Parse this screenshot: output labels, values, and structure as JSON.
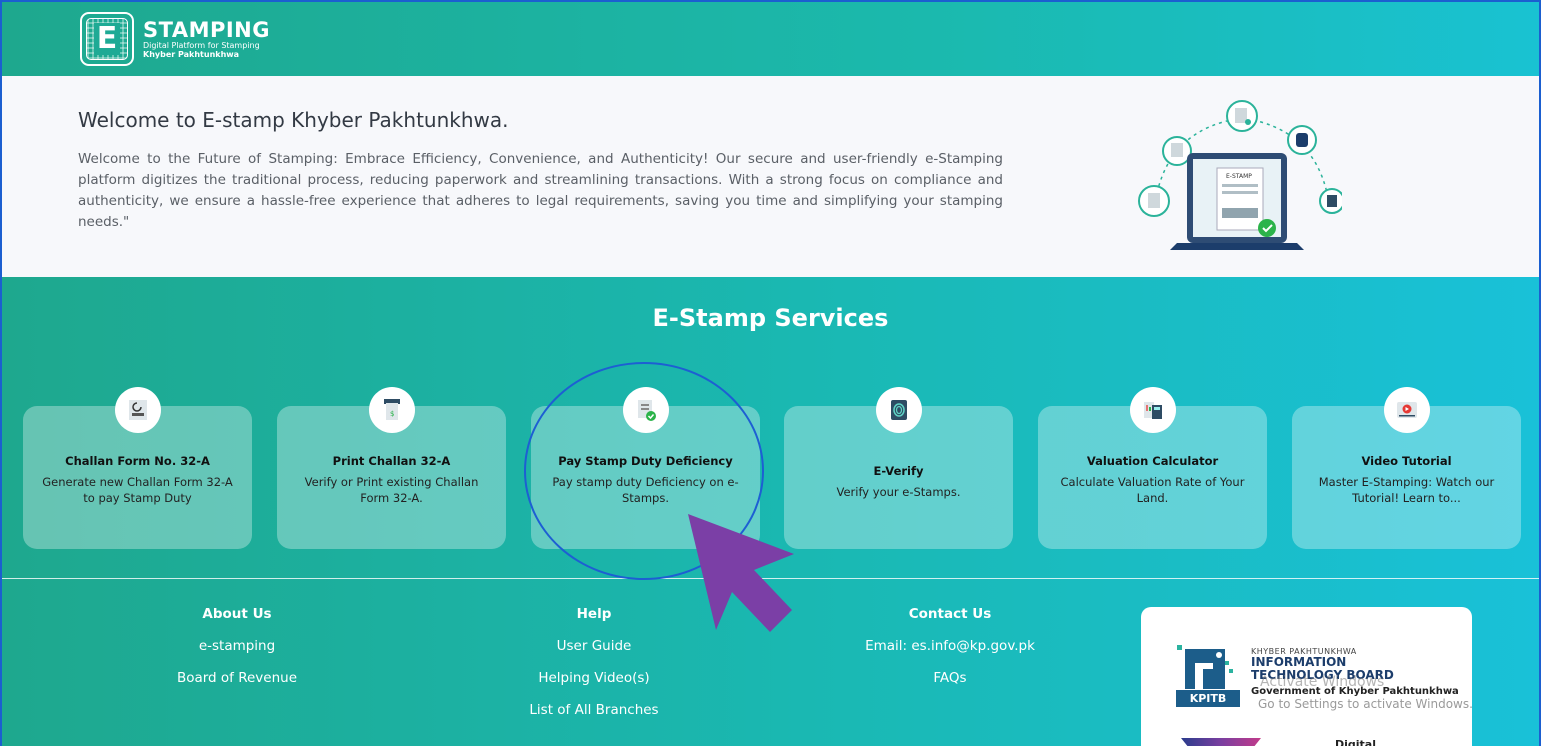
{
  "header": {
    "logo_letter": "E",
    "logo_title": "STAMPING",
    "logo_subtitle_line1": "Digital Platform for Stamping",
    "logo_subtitle_line2": "Khyber Pakhtunkhwa"
  },
  "welcome": {
    "title": "Welcome to E-stamp Khyber Pakhtunkhwa.",
    "body": "Welcome to the Future of Stamping: Embrace Efficiency, Convenience, and Authenticity! Our secure and user-friendly e-Stamping platform digitizes the traditional process, reducing paperwork and streamlining transactions. With a strong focus on compliance and authenticity, we ensure a hassle-free experience that adheres to legal requirements, saving you time and simplifying your stamping needs.\"",
    "illustration_label": "E-STAMP"
  },
  "services": {
    "title": "E-Stamp Services",
    "cards": [
      {
        "title": "Challan Form No. 32-A",
        "desc": "Generate new Challan Form 32-A to pay Stamp Duty",
        "icon": "receipt-icon"
      },
      {
        "title": "Print Challan 32-A",
        "desc": "Verify or Print existing Challan Form 32-A.",
        "icon": "printer-icon"
      },
      {
        "title": "Pay Stamp Duty Deficiency",
        "desc": "Pay stamp duty Deficiency on e-Stamps.",
        "icon": "document-check-icon"
      },
      {
        "title": "E-Verify",
        "desc": "Verify your e-Stamps.",
        "icon": "fingerprint-icon"
      },
      {
        "title": "Valuation Calculator",
        "desc": "Calculate Valuation Rate of Your Land.",
        "icon": "calculator-icon"
      },
      {
        "title": "Video Tutorial",
        "desc": "Master E-Stamping: Watch our Tutorial! Learn to...",
        "icon": "video-play-icon"
      }
    ]
  },
  "footer": {
    "about": {
      "heading": "About Us",
      "links": [
        "e-stamping",
        "Board of Revenue"
      ]
    },
    "help": {
      "heading": "Help",
      "links": [
        "User Guide",
        "Helping Video(s)",
        "List of All Branches"
      ]
    },
    "contact": {
      "heading": "Contact Us",
      "links": [
        "Email: es.info@kp.gov.pk",
        "FAQs"
      ]
    }
  },
  "partner": {
    "line1": "KHYBER PAKHTUNKHWA",
    "line2": "INFORMATION",
    "line3": "TECHNOLOGY BOARD",
    "line4": "Government of Khyber Pakhtunkhwa",
    "badge": "KPITB",
    "digital": "Digital"
  },
  "watermark": {
    "line1": "Activate Windows",
    "line2": "Go to Settings to activate Windows."
  },
  "colors": {
    "accent_start": "#1ea88e",
    "accent_end": "#19c1d8",
    "annotation_blue": "#1d5fd3",
    "cursor_purple": "#7b3fa6"
  }
}
